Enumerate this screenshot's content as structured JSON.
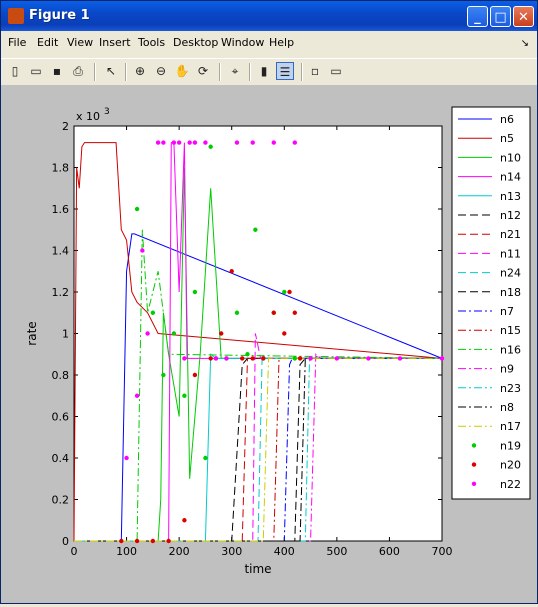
{
  "window": {
    "title": "Figure 1",
    "minimize": "_",
    "maximize": "□",
    "close": "✕"
  },
  "menu": [
    "File",
    "Edit",
    "View",
    "Insert",
    "Tools",
    "Desktop",
    "Window",
    "Help"
  ],
  "menu_dock_arrow": "↘",
  "toolbar": [
    "new-icon",
    "open-icon",
    "save-icon",
    "print-icon",
    "pointer-icon",
    "zoom-in-icon",
    "zoom-out-icon",
    "pan-icon",
    "rotate-icon",
    "data-cursor-icon",
    "colorbar-icon",
    "legend-icon",
    "hide-tools-icon",
    "plot-tools-icon"
  ],
  "chart_data": {
    "type": "line",
    "xlabel": "time",
    "ylabel": "rate",
    "exponent_label": "x 10",
    "exponent_power": "3",
    "xlim": [
      0,
      700
    ],
    "ylim": [
      0,
      2
    ],
    "xticks": [
      "0",
      "100",
      "200",
      "300",
      "400",
      "500",
      "600",
      "700"
    ],
    "yticks": [
      "0",
      "0.2",
      "0.4",
      "0.6",
      "0.8",
      "1",
      "1.2",
      "1.4",
      "1.6",
      "1.8",
      "2"
    ],
    "series": [
      {
        "name": "n6",
        "color": "#0000ff",
        "style": "solid",
        "x": [
          0,
          90,
          100,
          110,
          115,
          700
        ],
        "y": [
          0,
          0,
          1.3,
          1.48,
          1.48,
          0.88
        ]
      },
      {
        "name": "n5",
        "color": "#cc0000",
        "style": "solid",
        "x": [
          0,
          5,
          10,
          15,
          20,
          40,
          80,
          90,
          100,
          110,
          120,
          140,
          160,
          700
        ],
        "y": [
          0,
          1.8,
          1.7,
          1.9,
          1.92,
          1.92,
          1.92,
          1.5,
          1.45,
          1.2,
          1.15,
          1.1,
          1.0,
          0.88
        ]
      },
      {
        "name": "n10",
        "color": "#00cc00",
        "style": "solid",
        "x": [
          0,
          160,
          165,
          170,
          180,
          200,
          210,
          220,
          240,
          260,
          280,
          700
        ],
        "y": [
          0,
          0,
          0.2,
          1.1,
          0.9,
          0.6,
          1.8,
          0.3,
          0.9,
          1.7,
          0.88,
          0.88
        ]
      },
      {
        "name": "n14",
        "color": "#ff00ff",
        "style": "solid",
        "x": [
          0,
          180,
          185,
          190,
          200,
          210,
          215,
          700
        ],
        "y": [
          0,
          0,
          1.92,
          1.92,
          1.2,
          1.92,
          0.88,
          0.88
        ]
      },
      {
        "name": "n13",
        "color": "#00cccc",
        "style": "solid",
        "x": [
          0,
          250,
          260,
          270,
          280,
          700
        ],
        "y": [
          0,
          0,
          0.9,
          0.88,
          0.88,
          0.88
        ]
      },
      {
        "name": "n12",
        "color": "#000000",
        "style": "dashed",
        "x": [
          0,
          300,
          320,
          330,
          700
        ],
        "y": [
          0,
          0,
          0.85,
          0.88,
          0.88
        ]
      },
      {
        "name": "n21",
        "color": "#cc0000",
        "style": "dashed",
        "x": [
          0,
          320,
          330,
          335,
          700
        ],
        "y": [
          0,
          0,
          0.88,
          0.88,
          0.88
        ]
      },
      {
        "name": "n11",
        "color": "#ff00ff",
        "style": "dashed",
        "x": [
          0,
          340,
          345,
          355,
          700
        ],
        "y": [
          0,
          0,
          1.0,
          0.88,
          0.88
        ]
      },
      {
        "name": "n24",
        "color": "#00cccc",
        "style": "dashed",
        "x": [
          0,
          350,
          358,
          365,
          700
        ],
        "y": [
          0,
          0,
          0.9,
          0.88,
          0.88
        ]
      },
      {
        "name": "n18",
        "color": "#000000",
        "style": "dashed",
        "x": [
          0,
          420,
          430,
          440,
          700
        ],
        "y": [
          0,
          0,
          0.85,
          0.88,
          0.88
        ]
      },
      {
        "name": "n7",
        "color": "#0000ff",
        "style": "dashdot",
        "x": [
          0,
          400,
          410,
          415,
          700
        ],
        "y": [
          0,
          0,
          0.85,
          0.88,
          0.88
        ]
      },
      {
        "name": "n15",
        "color": "#cc0000",
        "style": "dashdot",
        "x": [
          0,
          380,
          390,
          700
        ],
        "y": [
          0,
          0,
          0.88,
          0.88
        ]
      },
      {
        "name": "n16",
        "color": "#00cc00",
        "style": "dashdot",
        "x": [
          0,
          120,
          130,
          140,
          160,
          180,
          700
        ],
        "y": [
          0,
          0,
          1.5,
          1.1,
          1.3,
          0.9,
          0.88
        ]
      },
      {
        "name": "n9",
        "color": "#ff00ff",
        "style": "dashdot",
        "x": [
          0,
          450,
          460,
          470,
          700
        ],
        "y": [
          0,
          0,
          0.9,
          0.88,
          0.88
        ]
      },
      {
        "name": "n23",
        "color": "#00cccc",
        "style": "dashdot",
        "x": [
          0,
          440,
          448,
          700
        ],
        "y": [
          0,
          0,
          0.88,
          0.88
        ]
      },
      {
        "name": "n8",
        "color": "#000000",
        "style": "dashdot",
        "x": [
          0,
          430,
          440,
          445,
          700
        ],
        "y": [
          0,
          0,
          0.88,
          0.88,
          0.88
        ]
      },
      {
        "name": "n17",
        "color": "#cccc00",
        "style": "dashdot",
        "x": [
          0,
          360,
          370,
          375,
          700
        ],
        "y": [
          0,
          0,
          0.88,
          0.88,
          0.88
        ]
      },
      {
        "name": "n19",
        "color": "#00cc00",
        "style": "marker",
        "x": [
          120,
          150,
          170,
          190,
          210,
          230,
          250,
          260,
          270,
          290,
          310,
          330,
          345,
          360,
          380,
          400,
          420
        ],
        "y": [
          1.6,
          1.1,
          0.8,
          1.0,
          0.7,
          1.2,
          0.4,
          1.9,
          0.88,
          0.88,
          1.1,
          0.9,
          1.5,
          0.88,
          1.1,
          1.2,
          0.88
        ]
      },
      {
        "name": "n20",
        "color": "#dd0000",
        "style": "marker",
        "x": [
          90,
          120,
          150,
          180,
          210,
          230,
          260,
          280,
          300,
          320,
          340,
          360,
          380,
          400,
          410,
          420,
          430
        ],
        "y": [
          0,
          0,
          0,
          0,
          0.1,
          0.8,
          0.88,
          1.0,
          1.3,
          0.88,
          0.88,
          0.88,
          1.1,
          1.0,
          1.2,
          1.1,
          0.88
        ]
      },
      {
        "name": "n22",
        "color": "#ff00ff",
        "style": "marker",
        "x": [
          100,
          120,
          130,
          140,
          160,
          170,
          190,
          200,
          210,
          220,
          230,
          250,
          270,
          290,
          310,
          340,
          380,
          420,
          450,
          500,
          560,
          620,
          700
        ],
        "y": [
          0.4,
          0.7,
          1.4,
          1.0,
          1.92,
          1.92,
          1.92,
          1.92,
          0.88,
          1.92,
          1.92,
          1.92,
          0.88,
          0.88,
          1.92,
          1.92,
          1.92,
          1.92,
          0.88,
          0.88,
          0.88,
          0.88,
          0.88
        ]
      }
    ]
  }
}
